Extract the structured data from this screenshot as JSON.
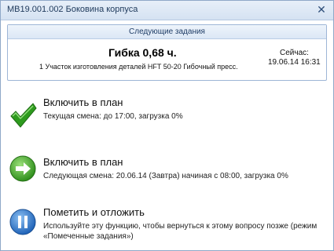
{
  "window": {
    "title": "МВ19.001.002 Боковина корпуса"
  },
  "panel": {
    "header": "Следующие задания",
    "task_title": "Гибка 0,68 ч.",
    "task_subtitle": "1 Участок изготовления деталей HFT 50-20 Гибочный пресс.",
    "now_label": "Сейчас:",
    "now_time": "19.06.14 16:31"
  },
  "options": [
    {
      "title": "Включить в план",
      "description": "Текущая смена: до 17:00, загрузка 0%",
      "icon": "green-check-icon"
    },
    {
      "title": "Включить в план",
      "description": "Следующая смена: 20.06.14 (Завтра) начиная с 08:00, загрузка 0%",
      "icon": "green-arrow-right-icon"
    },
    {
      "title": "Пометить и отложить",
      "description": "Используйте эту функцию, чтобы вернуться к этому вопросу позже (режим «Помеченные задания»)",
      "icon": "blue-pause-icon"
    }
  ],
  "colors": {
    "title_bar": "#d5e2f2",
    "check_green": "#2e9b1e",
    "pause_blue": "#1f63b8"
  }
}
